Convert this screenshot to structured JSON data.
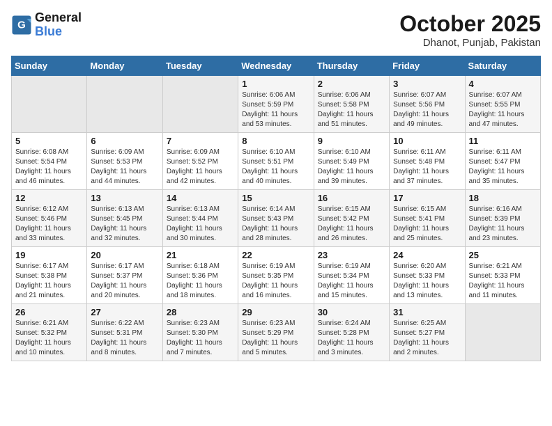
{
  "logo": {
    "line1": "General",
    "line2": "Blue"
  },
  "title": "October 2025",
  "location": "Dhanot, Punjab, Pakistan",
  "weekdays": [
    "Sunday",
    "Monday",
    "Tuesday",
    "Wednesday",
    "Thursday",
    "Friday",
    "Saturday"
  ],
  "weeks": [
    [
      {
        "day": "",
        "info": ""
      },
      {
        "day": "",
        "info": ""
      },
      {
        "day": "",
        "info": ""
      },
      {
        "day": "1",
        "info": "Sunrise: 6:06 AM\nSunset: 5:59 PM\nDaylight: 11 hours and 53 minutes."
      },
      {
        "day": "2",
        "info": "Sunrise: 6:06 AM\nSunset: 5:58 PM\nDaylight: 11 hours and 51 minutes."
      },
      {
        "day": "3",
        "info": "Sunrise: 6:07 AM\nSunset: 5:56 PM\nDaylight: 11 hours and 49 minutes."
      },
      {
        "day": "4",
        "info": "Sunrise: 6:07 AM\nSunset: 5:55 PM\nDaylight: 11 hours and 47 minutes."
      }
    ],
    [
      {
        "day": "5",
        "info": "Sunrise: 6:08 AM\nSunset: 5:54 PM\nDaylight: 11 hours and 46 minutes."
      },
      {
        "day": "6",
        "info": "Sunrise: 6:09 AM\nSunset: 5:53 PM\nDaylight: 11 hours and 44 minutes."
      },
      {
        "day": "7",
        "info": "Sunrise: 6:09 AM\nSunset: 5:52 PM\nDaylight: 11 hours and 42 minutes."
      },
      {
        "day": "8",
        "info": "Sunrise: 6:10 AM\nSunset: 5:51 PM\nDaylight: 11 hours and 40 minutes."
      },
      {
        "day": "9",
        "info": "Sunrise: 6:10 AM\nSunset: 5:49 PM\nDaylight: 11 hours and 39 minutes."
      },
      {
        "day": "10",
        "info": "Sunrise: 6:11 AM\nSunset: 5:48 PM\nDaylight: 11 hours and 37 minutes."
      },
      {
        "day": "11",
        "info": "Sunrise: 6:11 AM\nSunset: 5:47 PM\nDaylight: 11 hours and 35 minutes."
      }
    ],
    [
      {
        "day": "12",
        "info": "Sunrise: 6:12 AM\nSunset: 5:46 PM\nDaylight: 11 hours and 33 minutes."
      },
      {
        "day": "13",
        "info": "Sunrise: 6:13 AM\nSunset: 5:45 PM\nDaylight: 11 hours and 32 minutes."
      },
      {
        "day": "14",
        "info": "Sunrise: 6:13 AM\nSunset: 5:44 PM\nDaylight: 11 hours and 30 minutes."
      },
      {
        "day": "15",
        "info": "Sunrise: 6:14 AM\nSunset: 5:43 PM\nDaylight: 11 hours and 28 minutes."
      },
      {
        "day": "16",
        "info": "Sunrise: 6:15 AM\nSunset: 5:42 PM\nDaylight: 11 hours and 26 minutes."
      },
      {
        "day": "17",
        "info": "Sunrise: 6:15 AM\nSunset: 5:41 PM\nDaylight: 11 hours and 25 minutes."
      },
      {
        "day": "18",
        "info": "Sunrise: 6:16 AM\nSunset: 5:39 PM\nDaylight: 11 hours and 23 minutes."
      }
    ],
    [
      {
        "day": "19",
        "info": "Sunrise: 6:17 AM\nSunset: 5:38 PM\nDaylight: 11 hours and 21 minutes."
      },
      {
        "day": "20",
        "info": "Sunrise: 6:17 AM\nSunset: 5:37 PM\nDaylight: 11 hours and 20 minutes."
      },
      {
        "day": "21",
        "info": "Sunrise: 6:18 AM\nSunset: 5:36 PM\nDaylight: 11 hours and 18 minutes."
      },
      {
        "day": "22",
        "info": "Sunrise: 6:19 AM\nSunset: 5:35 PM\nDaylight: 11 hours and 16 minutes."
      },
      {
        "day": "23",
        "info": "Sunrise: 6:19 AM\nSunset: 5:34 PM\nDaylight: 11 hours and 15 minutes."
      },
      {
        "day": "24",
        "info": "Sunrise: 6:20 AM\nSunset: 5:33 PM\nDaylight: 11 hours and 13 minutes."
      },
      {
        "day": "25",
        "info": "Sunrise: 6:21 AM\nSunset: 5:33 PM\nDaylight: 11 hours and 11 minutes."
      }
    ],
    [
      {
        "day": "26",
        "info": "Sunrise: 6:21 AM\nSunset: 5:32 PM\nDaylight: 11 hours and 10 minutes."
      },
      {
        "day": "27",
        "info": "Sunrise: 6:22 AM\nSunset: 5:31 PM\nDaylight: 11 hours and 8 minutes."
      },
      {
        "day": "28",
        "info": "Sunrise: 6:23 AM\nSunset: 5:30 PM\nDaylight: 11 hours and 7 minutes."
      },
      {
        "day": "29",
        "info": "Sunrise: 6:23 AM\nSunset: 5:29 PM\nDaylight: 11 hours and 5 minutes."
      },
      {
        "day": "30",
        "info": "Sunrise: 6:24 AM\nSunset: 5:28 PM\nDaylight: 11 hours and 3 minutes."
      },
      {
        "day": "31",
        "info": "Sunrise: 6:25 AM\nSunset: 5:27 PM\nDaylight: 11 hours and 2 minutes."
      },
      {
        "day": "",
        "info": ""
      }
    ]
  ]
}
